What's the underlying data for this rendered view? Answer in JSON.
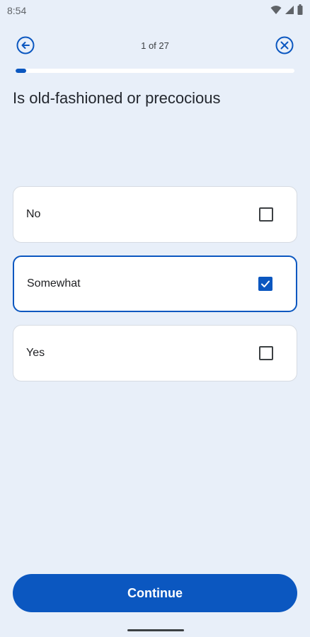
{
  "status_bar": {
    "time": "8:54",
    "icons": [
      "wifi-icon",
      "signal-icon",
      "battery-icon"
    ]
  },
  "header": {
    "counter": "1 of 27",
    "back_icon": "back-arrow-icon",
    "close_icon": "close-icon",
    "progress_fraction": 0.037
  },
  "question": {
    "text": "Is old-fashioned or precocious"
  },
  "options": [
    {
      "label": "No",
      "checked": false
    },
    {
      "label": "Somewhat",
      "checked": true
    },
    {
      "label": "Yes",
      "checked": false
    }
  ],
  "footer": {
    "continue_label": "Continue"
  },
  "colors": {
    "background": "#e8eff9",
    "accent": "#0b57c0",
    "card": "#ffffff"
  }
}
